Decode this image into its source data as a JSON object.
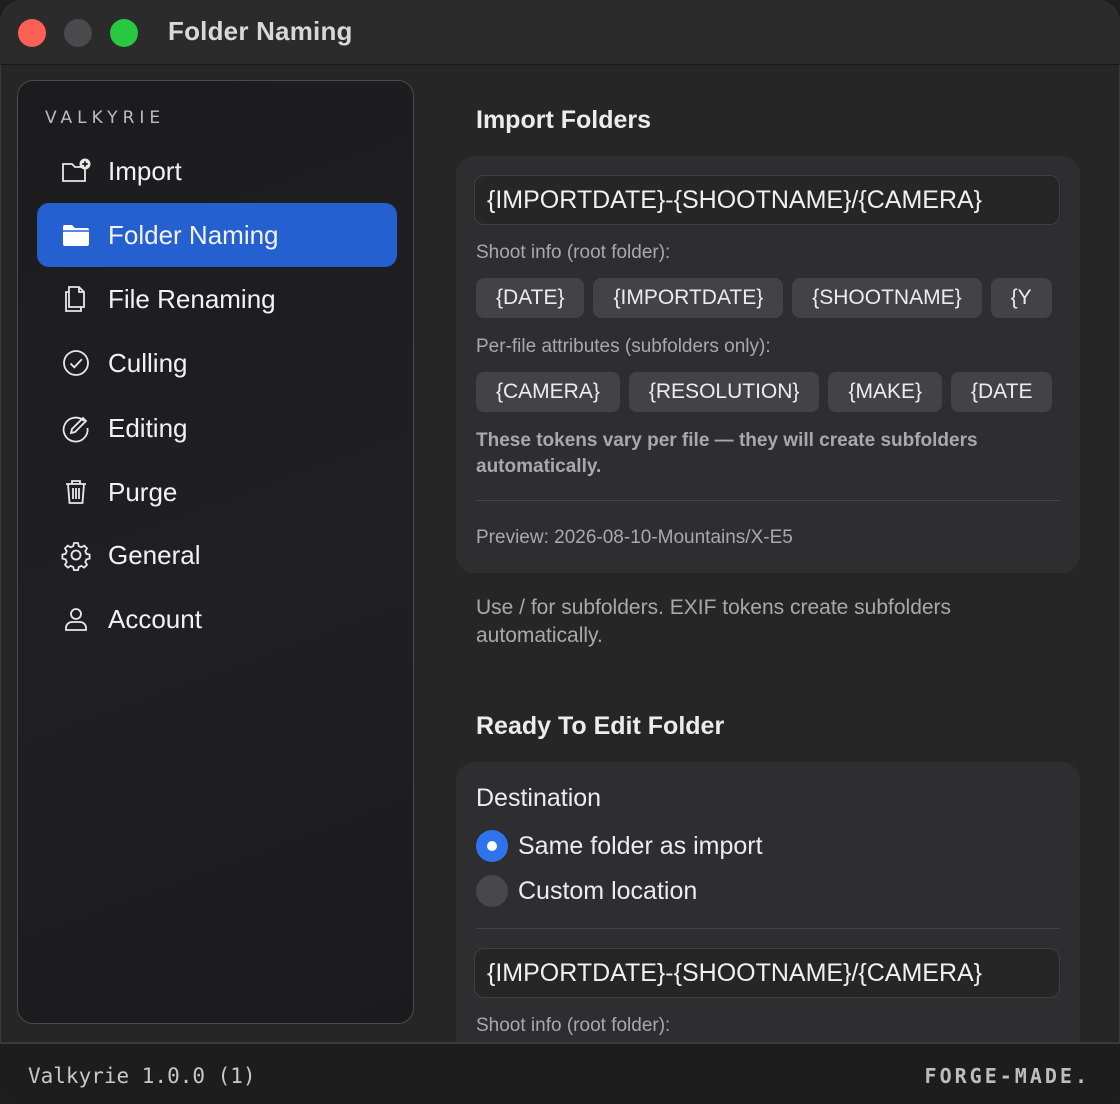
{
  "window": {
    "title": "Folder Naming"
  },
  "sidebar": {
    "brand": "VALKYRIE",
    "items": [
      {
        "label": "Import",
        "icon": "folder-plus-icon",
        "active": false
      },
      {
        "label": "Folder Naming",
        "icon": "folder-icon",
        "active": true
      },
      {
        "label": "File Renaming",
        "icon": "documents-icon",
        "active": false
      },
      {
        "label": "Culling",
        "icon": "checkmark-circle-icon",
        "active": false
      },
      {
        "label": "Editing",
        "icon": "edit-circle-icon",
        "active": false
      },
      {
        "label": "Purge",
        "icon": "trash-icon",
        "active": false
      },
      {
        "label": "General",
        "icon": "gear-icon",
        "active": false
      },
      {
        "label": "Account",
        "icon": "person-icon",
        "active": false
      }
    ]
  },
  "import_folders": {
    "title": "Import Folders",
    "pattern": "{IMPORTDATE}-{SHOOTNAME}/{CAMERA}",
    "shoot_info_label": "Shoot info (root folder):",
    "shoot_tokens": [
      "{DATE}",
      "{IMPORTDATE}",
      "{SHOOTNAME}",
      "{Y"
    ],
    "per_file_label": "Per-file attributes (subfolders only):",
    "per_file_tokens": [
      "{CAMERA}",
      "{RESOLUTION}",
      "{MAKE}",
      "{DATE"
    ],
    "note": "These tokens vary per file — they will create subfolders automatically.",
    "preview": "Preview: 2026-08-10-Mountains/X-E5",
    "help": "Use / for subfolders. EXIF tokens create subfolders automatically."
  },
  "ready_to_edit": {
    "title": "Ready To Edit Folder",
    "destination_label": "Destination",
    "options": [
      {
        "label": "Same folder as import",
        "selected": true
      },
      {
        "label": "Custom location",
        "selected": false
      }
    ],
    "pattern": "{IMPORTDATE}-{SHOOTNAME}/{CAMERA}",
    "shoot_info_label": "Shoot info (root folder):"
  },
  "footer": {
    "version": "Valkyrie 1.0.0 (1)",
    "maker": "FORGE-MADE."
  },
  "colors": {
    "accent": "#2560d1",
    "radio_on": "#2f74ec",
    "close": "#fe5f57",
    "zoom": "#28c840"
  }
}
